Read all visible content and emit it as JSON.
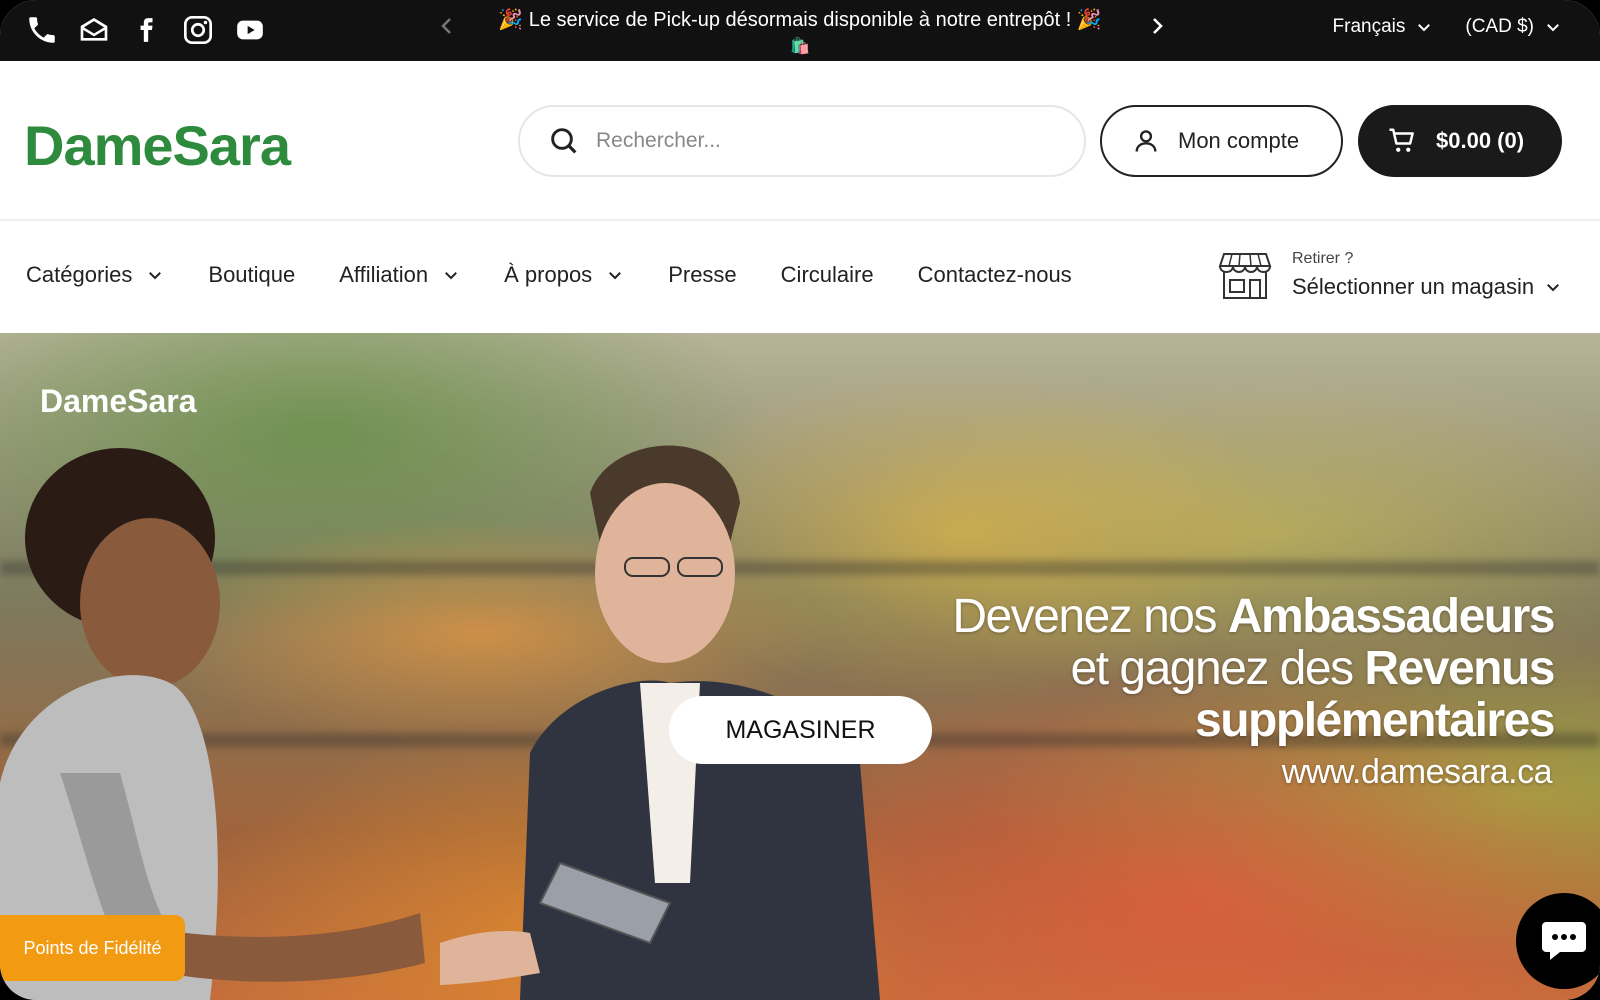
{
  "topbar": {
    "social_icons": [
      "phone-icon",
      "mail-icon",
      "facebook-icon",
      "instagram-icon",
      "youtube-icon"
    ],
    "announcement": "🎉 Le service de Pick-up désormais disponible à notre entrepôt ! 🎉",
    "announcement_emoji": "🛍️",
    "language": "Français",
    "currency": "(CAD $)"
  },
  "header": {
    "logo_text": "DameSara",
    "search_placeholder": "Rechercher...",
    "account_label": "Mon compte",
    "cart_label": "$0.00 (0)"
  },
  "nav": {
    "items": [
      {
        "label": "Catégories",
        "dropdown": true
      },
      {
        "label": "Boutique",
        "dropdown": false
      },
      {
        "label": "Affiliation",
        "dropdown": true
      },
      {
        "label": "À propos",
        "dropdown": true
      },
      {
        "label": "Presse",
        "dropdown": false
      },
      {
        "label": "Circulaire",
        "dropdown": false
      },
      {
        "label": "Contactez-nous",
        "dropdown": false
      }
    ],
    "store_hint": "Retirer ?",
    "store_select": "Sélectionner un magasin"
  },
  "hero": {
    "logo_text": "DameSara",
    "line1_light": "Devenez nos ",
    "line1_bold": "Ambassadeurs",
    "line2_light": "et gagnez des ",
    "line2_bold": "Revenus",
    "line3_bold": "supplémentaires",
    "url": "www.damesara.ca",
    "cta": "MAGASINER"
  },
  "widgets": {
    "loyalty": "Points de Fidélité",
    "chat_icon": "chat-bubble-icon"
  },
  "colors": {
    "brand_green": "#2e8b3e",
    "topbar_bg": "#111111",
    "cart_bg": "#1a1a1a",
    "loyalty_orange": "#f29a12"
  }
}
